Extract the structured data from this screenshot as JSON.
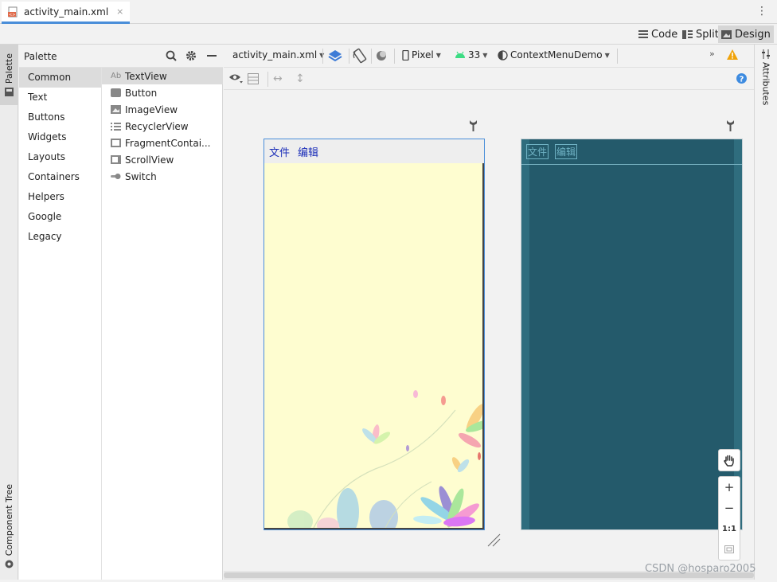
{
  "file_tab": {
    "name": "activity_main.xml",
    "close": "×"
  },
  "view_modes": {
    "code": "Code",
    "split": "Split",
    "design": "Design"
  },
  "left_strip": {
    "palette": "Palette",
    "component_tree": "Component Tree"
  },
  "palette": {
    "title": "Palette",
    "categories": [
      "Common",
      "Text",
      "Buttons",
      "Widgets",
      "Layouts",
      "Containers",
      "Helpers",
      "Google",
      "Legacy"
    ],
    "items": [
      {
        "label": "TextView",
        "icon": "text-ab-icon"
      },
      {
        "label": "Button",
        "icon": "button-icon"
      },
      {
        "label": "ImageView",
        "icon": "image-icon"
      },
      {
        "label": "RecyclerView",
        "icon": "list-icon"
      },
      {
        "label": "FragmentContai...",
        "icon": "fragment-icon"
      },
      {
        "label": "ScrollView",
        "icon": "scroll-icon"
      },
      {
        "label": "Switch",
        "icon": "switch-icon"
      }
    ]
  },
  "design_toolbar": {
    "file": "activity_main.xml",
    "device": "Pixel",
    "api": "33",
    "theme": "ContextMenuDemo"
  },
  "design_preview": {
    "menu_file": "文件",
    "menu_edit": "编辑"
  },
  "blueprint_preview": {
    "menu_file": "文件",
    "menu_edit": "编辑"
  },
  "zoom": {
    "zoom_in": "+",
    "zoom_out": "−",
    "one_to_one": "1:1"
  },
  "right_strip": {
    "attributes": "Attributes"
  },
  "watermark": "CSDN @hosparo2005",
  "colors": {
    "accent": "#4a8ed9",
    "design_bg": "#fefdd0",
    "blueprint_bg": "#245a6b",
    "menu_text": "#1a2db8"
  }
}
